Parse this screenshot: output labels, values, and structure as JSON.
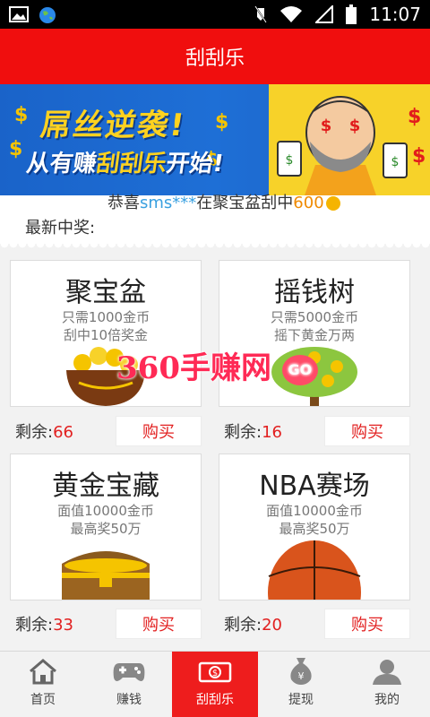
{
  "status_bar": {
    "time": "11:07"
  },
  "header": {
    "title": "刮刮乐"
  },
  "banner": {
    "line1": "屌丝逆袭!",
    "line2_prefix": "从有赚",
    "line2_highlight": "刮刮乐",
    "line2_suffix": "开始!"
  },
  "winner": {
    "prefix": "恭喜",
    "user": "sms***",
    "middle": "在聚宝盆刮中",
    "amount": "600",
    "label": "最新中奖:"
  },
  "cards": [
    {
      "name": "聚宝盆",
      "sub1": "只需1000金币",
      "sub2": "刮中10倍奖金",
      "remain_label": "剩余:",
      "remain": "66",
      "buy": "购买",
      "icon": "treasure-bowl-icon"
    },
    {
      "name": "摇钱树",
      "sub1": "只需5000金币",
      "sub2": "摇下黄金万两",
      "remain_label": "剩余:",
      "remain": "16",
      "buy": "购买",
      "icon": "money-tree-icon"
    },
    {
      "name": "黄金宝藏",
      "sub1": "面值10000金币",
      "sub2": "最高奖50万",
      "remain_label": "剩余:",
      "remain": "33",
      "buy": "购买",
      "icon": "treasure-chest-icon"
    },
    {
      "name": "NBA赛场",
      "sub1": "面值10000金币",
      "sub2": "最高奖50万",
      "remain_label": "剩余:",
      "remain": "20",
      "buy": "购买",
      "icon": "basketball-icon"
    }
  ],
  "watermark": {
    "text": "360手赚网",
    "badge": "GO"
  },
  "tabs": [
    {
      "label": "首页",
      "icon": "home-icon"
    },
    {
      "label": "赚钱",
      "icon": "gamepad-icon"
    },
    {
      "label": "刮刮乐",
      "icon": "money-bill-icon"
    },
    {
      "label": "提现",
      "icon": "money-bag-icon"
    },
    {
      "label": "我的",
      "icon": "user-icon"
    }
  ],
  "colors": {
    "primary": "#f00e0e",
    "accent_red": "#e22020",
    "banner_blue": "#1e6fd6",
    "banner_yellow": "#f7d229"
  }
}
